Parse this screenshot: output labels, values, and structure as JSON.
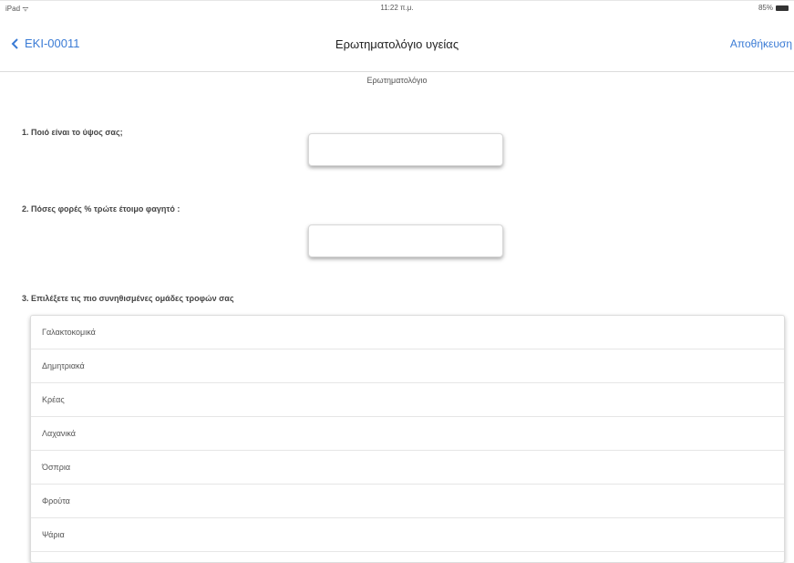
{
  "status_bar": {
    "carrier": "iPad ᯤ",
    "time": "11:22 π.μ.",
    "battery": "85%"
  },
  "nav": {
    "back_label": "EKI-00011",
    "title": "Ερωτηματολόγιο υγείας",
    "save_label": "Αποθήκευση"
  },
  "section_tab": "Ερωτηματολόγιο",
  "questions": {
    "q1": {
      "label": "1. Ποιό είναι το ύψος σας;",
      "value": ""
    },
    "q2": {
      "label": "2. Πόσες φορές % τρώτε έτοιμο φαγητό :",
      "value": ""
    },
    "q3": {
      "label": "3. Επιλέξετε τις πιο συνηθισμένες ομάδες τροφών σας",
      "options": [
        "Γαλακτοκομικά",
        "Δημητριακά",
        "Κρέας",
        "Λαχανικά",
        "Όσπρια",
        "Φρούτα",
        "Ψάρια"
      ]
    }
  },
  "colors": {
    "accent": "#3a7bd5"
  }
}
